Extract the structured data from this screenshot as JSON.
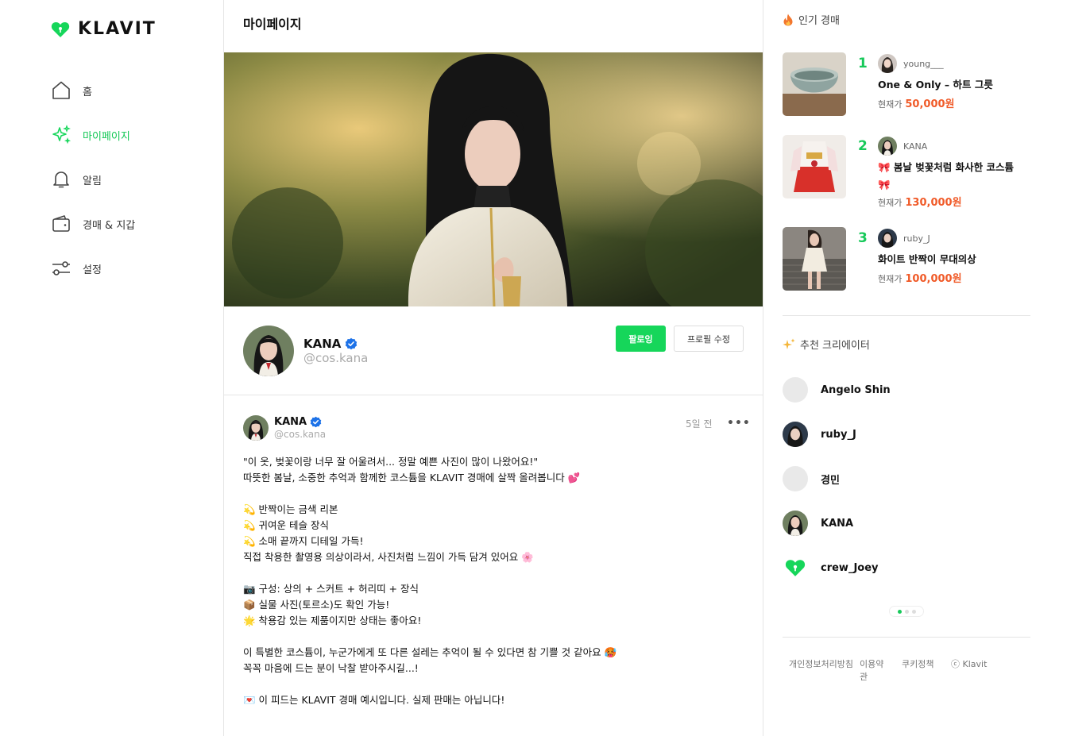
{
  "brand": {
    "name": "KLAVIT",
    "accent": "#16d65a"
  },
  "nav": [
    {
      "label": "홈",
      "icon": "home-icon"
    },
    {
      "label": "마이페이지",
      "icon": "sparkle-icon",
      "active": true
    },
    {
      "label": "알림",
      "icon": "bell-icon"
    },
    {
      "label": "경매 & 지갑",
      "icon": "wallet-icon"
    },
    {
      "label": "설정",
      "icon": "settings-toggle-icon"
    }
  ],
  "main": {
    "title": "마이페이지",
    "profile": {
      "name": "KANA",
      "handle": "@cos.kana",
      "follow_label": "팔로잉",
      "edit_label": "프로필 수정"
    },
    "post": {
      "author": "KANA",
      "handle": "@cos.kana",
      "time": "5일 전",
      "more": "•••",
      "lines": [
        "\"이 옷, 벚꽃이랑 너무 잘 어울려서... 정말 예쁜 사진이 많이 나왔어요!\"",
        "따뜻한 봄날, 소중한 추억과 함께한 코스튬을 KLAVIT 경매에 살짝 올려봅니다 💕",
        "",
        "💫 반짝이는 금색 리본",
        "💫 귀여운 테슬 장식",
        "💫 소매 끝까지 디테일 가득!",
        "직접 착용한 촬영용 의상이라서, 사진처럼 느낌이 가득 담겨 있어요 🌸",
        "",
        "📷 구성: 상의 + 스커트 + 허리띠 + 장식",
        "📦 실물 사진(토르소)도 확인 가능!",
        "🌟 착용감 있는 제품이지만 상태는 좋아요!",
        "",
        "이 특별한 코스튬이, 누군가에게 또 다른 설레는 추억이 될 수 있다면 참 기쁠 것 같아요 🥵",
        "꼭꼭 마음에 드는 분이 낙찰 받아주시길...!",
        "",
        "💌 이 피드는 KLAVIT 경매 예시입니다. 실제 판매는 아닙니다!"
      ]
    }
  },
  "popular": {
    "title": "인기 경매",
    "title_icon": "fire-icon",
    "price_prefix": "현재가",
    "items": [
      {
        "rank": "1",
        "seller": "young___",
        "title": "One & Only – 하트 그릇",
        "price": "50,000원"
      },
      {
        "rank": "2",
        "seller": "KANA",
        "title": "🎀 봄날 벚꽃처럼 화사한 코스튬 🎀",
        "price": "130,000원"
      },
      {
        "rank": "3",
        "seller": "ruby_J",
        "title": "화이트 반짝이 무대의상",
        "price": "100,000원"
      }
    ]
  },
  "creators": {
    "title": "추천 크리에이터",
    "title_icon": "sparkles-icon",
    "items": [
      {
        "name": "Angelo Shin"
      },
      {
        "name": "ruby_J"
      },
      {
        "name": "경민"
      },
      {
        "name": "KANA"
      },
      {
        "name": "crew_Joey"
      }
    ]
  },
  "footer": {
    "privacy": "개인정보처리방침",
    "terms": "이용약관",
    "cookies": "쿠키정책",
    "copyright": "ⓒ Klavit"
  }
}
